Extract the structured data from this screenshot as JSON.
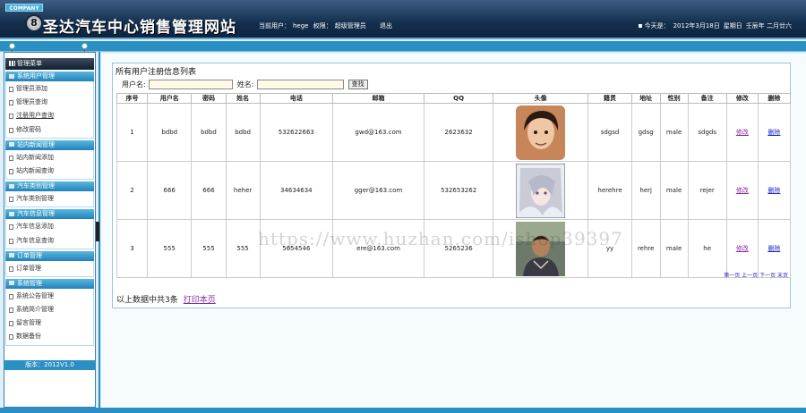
{
  "header": {
    "badge": "COMPANY",
    "logo_glyph": "8",
    "title": "圣达汽车中心销售管理网站",
    "current_user_label": "当前用户：",
    "current_user": "hege",
    "role_label": "权限：",
    "role": "超级管理员",
    "logout": "退出",
    "today_label": "今天是：",
    "today_date": "2012年3月18日",
    "weekday": "星期日",
    "lunar": "壬辰年 二月廿六"
  },
  "sidebar": {
    "menu_title": "管理菜单",
    "groups": [
      {
        "title": "系统用户管理",
        "items": [
          "管理员添加",
          "管理员查询",
          "注册用户查询",
          "修改密码"
        ]
      },
      {
        "title": "站内新闻管理",
        "items": [
          "站内新闻添加",
          "站内新闻查询"
        ]
      },
      {
        "title": "汽车类别管理",
        "items": [
          "汽车类别管理"
        ]
      },
      {
        "title": "汽车信息管理",
        "items": [
          "汽车信息添加",
          "汽车信息查询"
        ]
      },
      {
        "title": "订单管理",
        "items": [
          "订单管理"
        ]
      },
      {
        "title": "系统管理",
        "items": [
          "系统公告管理",
          "系统简介管理",
          "留言管理",
          "数据备份"
        ]
      }
    ],
    "version": "版本：2012V1.0"
  },
  "main": {
    "title": "所有用户注册信息列表",
    "search": {
      "username_label": "用户名:",
      "username_value": "",
      "name_label": "姓名:",
      "name_value": "",
      "button": "查找"
    },
    "columns": [
      "序号",
      "用户名",
      "密码",
      "姓名",
      "电话",
      "邮箱",
      "QQ",
      "头像",
      "籍贯",
      "地址",
      "性别",
      "备注",
      "修改",
      "删除"
    ],
    "rows": [
      {
        "no": "1",
        "username": "bdbd",
        "password": "bdbd",
        "name": "bdbd",
        "phone": "532622663",
        "email": "gwd@163.com",
        "qq": "2623632",
        "native": "sdgsd",
        "address": "gdsg",
        "sex": "male",
        "remark": "sdgds",
        "edit": "修改",
        "delete": "删除",
        "avatar": "avatar-photo-1"
      },
      {
        "no": "2",
        "username": "666",
        "password": "666",
        "name": "heher",
        "phone": "34634634",
        "email": "gger@163.com",
        "qq": "532653262",
        "native": "herehre",
        "address": "herj",
        "sex": "male",
        "remark": "rejer",
        "edit": "修改",
        "delete": "删除",
        "avatar": "avatar-photo-2"
      },
      {
        "no": "3",
        "username": "555",
        "password": "555",
        "name": "555",
        "phone": "5654546",
        "email": "ere@163.com",
        "qq": "5265236",
        "native": "yy",
        "address": "rehre",
        "sex": "male",
        "remark": "he",
        "edit": "修改",
        "delete": "删除",
        "avatar": "avatar-photo-3"
      }
    ],
    "pager": "第一页 上一页 下一页 末页",
    "summary": "以上数据中共3条",
    "print_link": "打印本页"
  },
  "watermark": "https://www.huzhan.com/ishop39397",
  "colors": {
    "header_dark": "#14304f",
    "accent_blue": "#2a90c4",
    "link": "#2328c9",
    "visited_link": "#8a2ca0"
  }
}
